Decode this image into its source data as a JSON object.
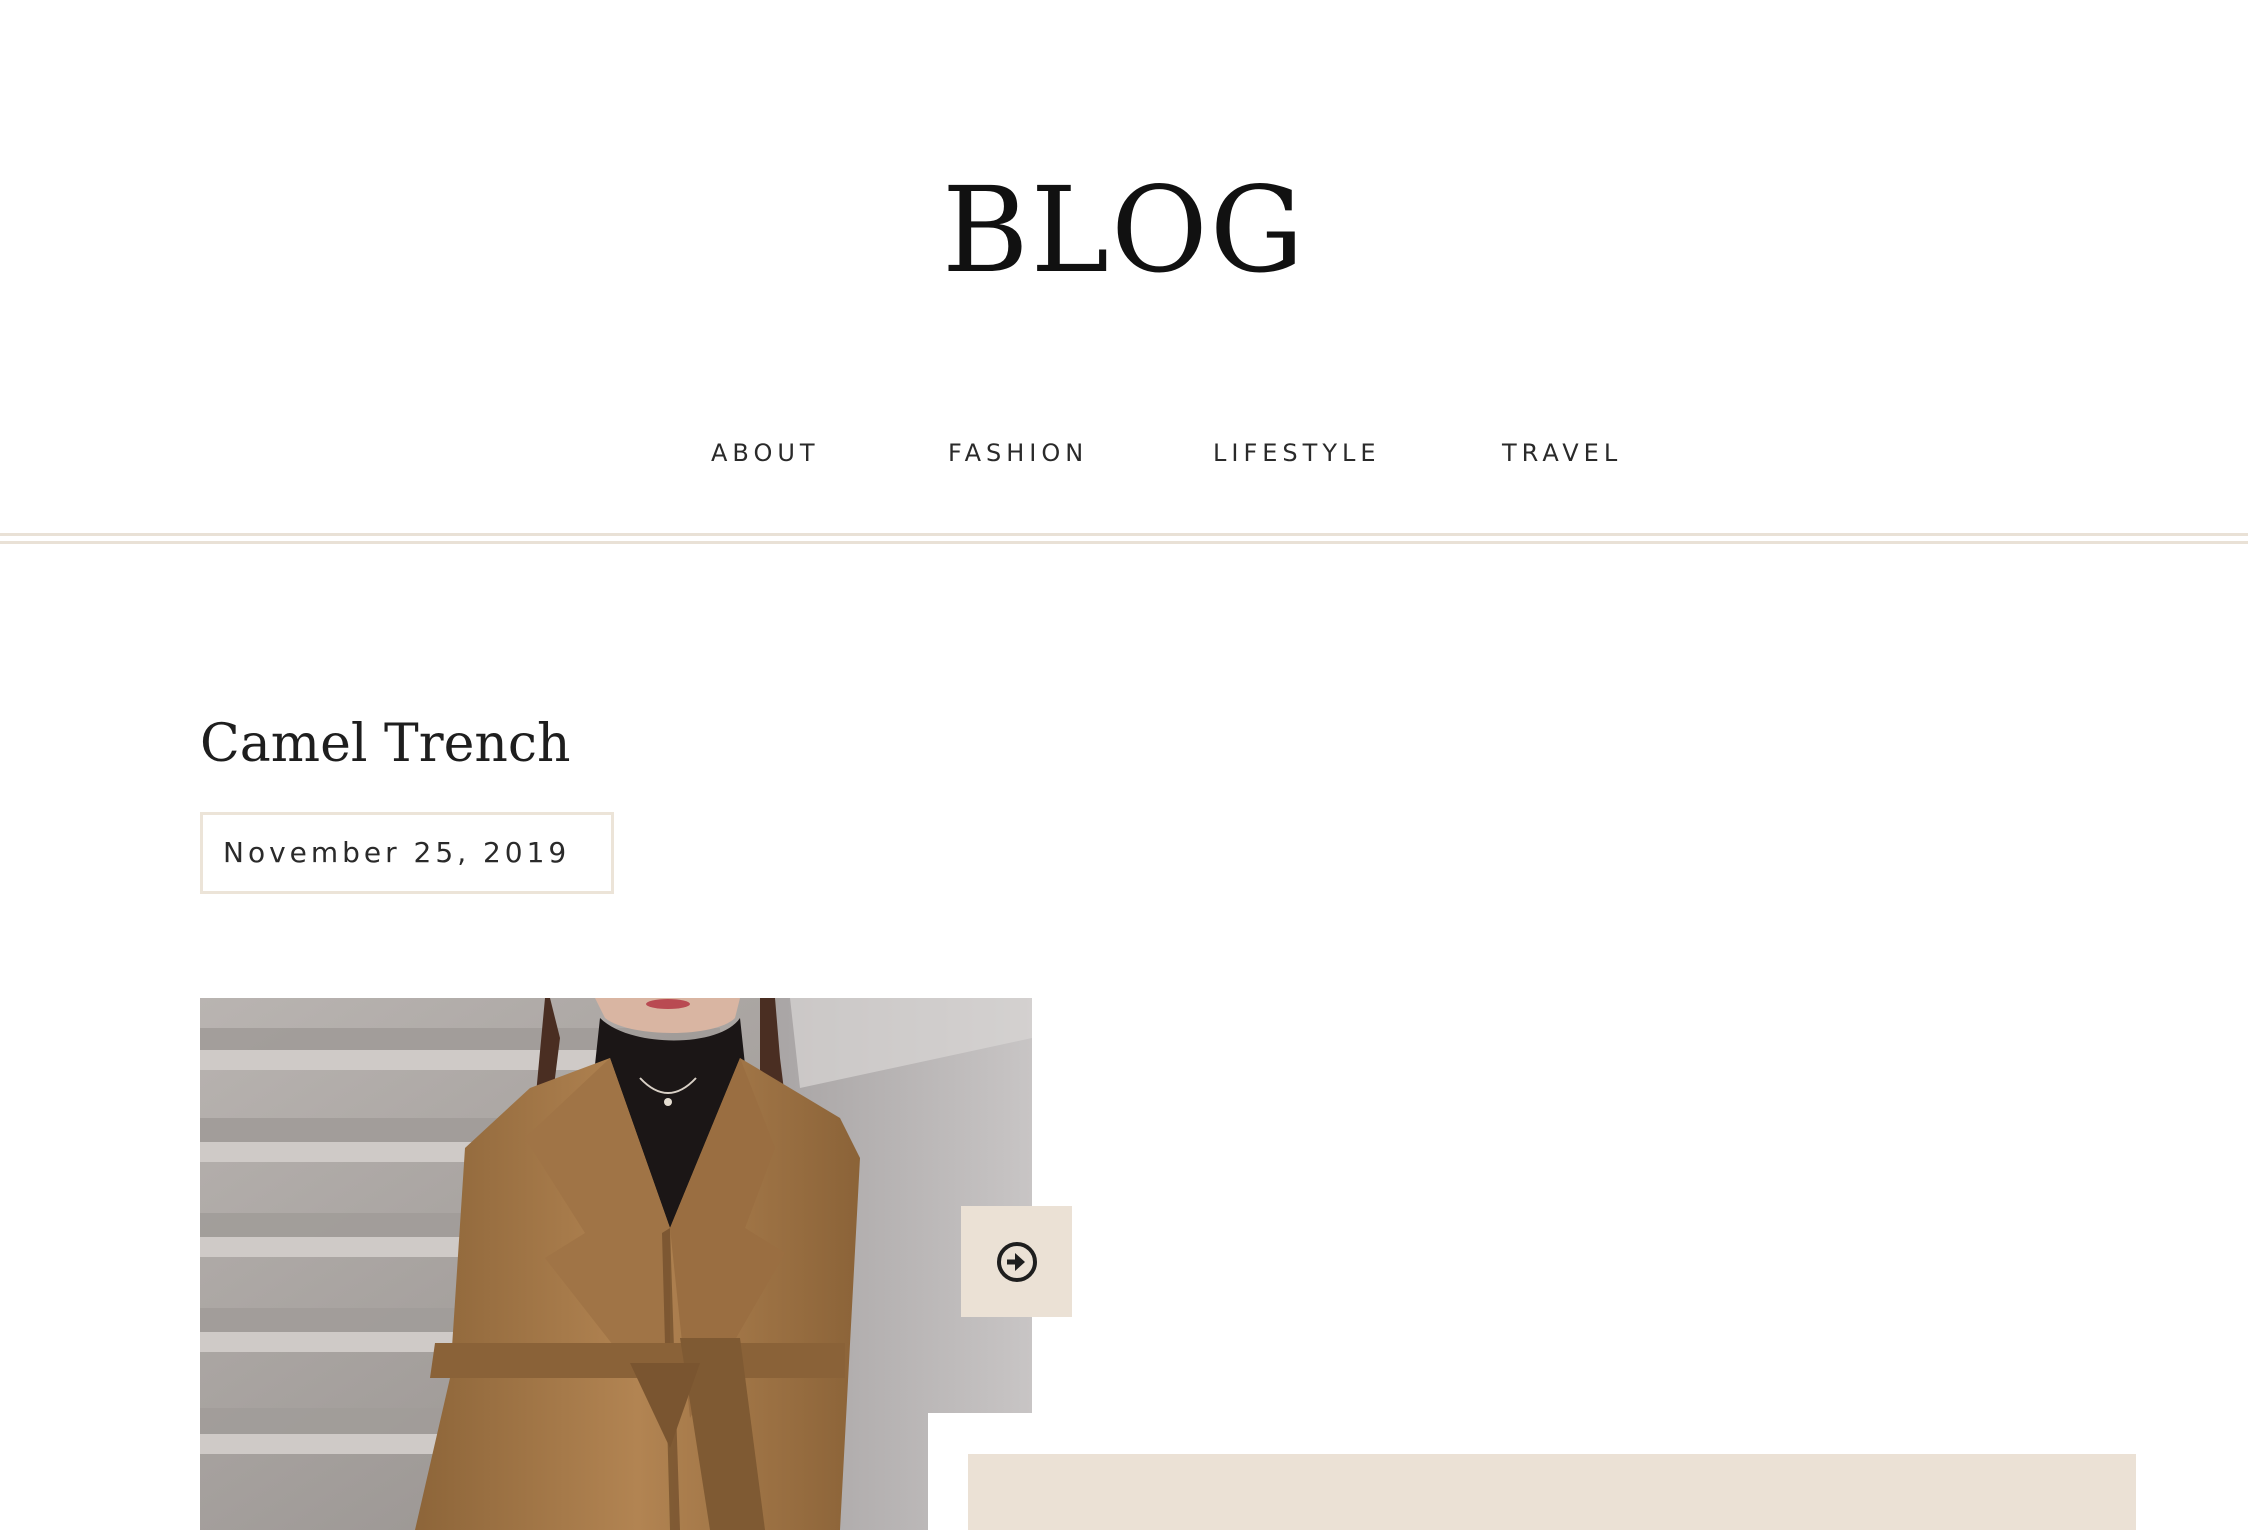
{
  "site": {
    "title": "BLOG"
  },
  "nav": {
    "items": [
      {
        "label": "ABOUT"
      },
      {
        "label": "FASHION"
      },
      {
        "label": "LIFESTYLE"
      },
      {
        "label": "TRAVEL"
      }
    ]
  },
  "post": {
    "title": "Camel Trench",
    "date": "November 25, 2019",
    "image_icon": "photo-woman-camel-coat"
  },
  "controls": {
    "next_icon": "arrow-right-circle-icon"
  },
  "colors": {
    "accent_beige": "#ebe1d5",
    "divider": "#e9e1d6",
    "text": "#1c1c1c"
  }
}
